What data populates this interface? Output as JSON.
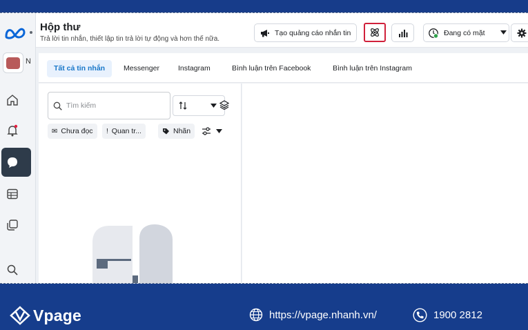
{
  "rail": {
    "page_initial": "N",
    "icons": [
      "meta-logo",
      "home-icon",
      "notification-bell-icon",
      "inbox-chat-icon",
      "table-icon",
      "pages-icon",
      "search-icon"
    ]
  },
  "header": {
    "title": "Hộp thư",
    "subtitle": "Trả lời tin nhắn, thiết lập tin trả lời tự động và hơn thế nữa.",
    "ad_button_label": "Tạo quảng cáo nhắn tin",
    "status_label": "Đang có mặt"
  },
  "tabs": [
    {
      "label": "Tất cả tin nhắn",
      "active": true
    },
    {
      "label": "Messenger",
      "active": false
    },
    {
      "label": "Instagram",
      "active": false
    },
    {
      "label": "Bình luận trên Facebook",
      "active": false
    },
    {
      "label": "Bình luận trên Instagram",
      "active": false
    }
  ],
  "list": {
    "search_placeholder": "Tìm kiếm",
    "chips": [
      {
        "label": "Chưa đọc"
      },
      {
        "label": "Quan tr..."
      },
      {
        "label": "Nhãn"
      }
    ]
  },
  "footer": {
    "brand": "Vpage",
    "url": "https://vpage.nhanh.vn/",
    "phone": "1900 2812"
  },
  "colors": {
    "brand_blue": "#163d8c",
    "active_tab_text": "#1877c9",
    "highlight_border": "#d0203a",
    "online_green": "#31a24c"
  }
}
